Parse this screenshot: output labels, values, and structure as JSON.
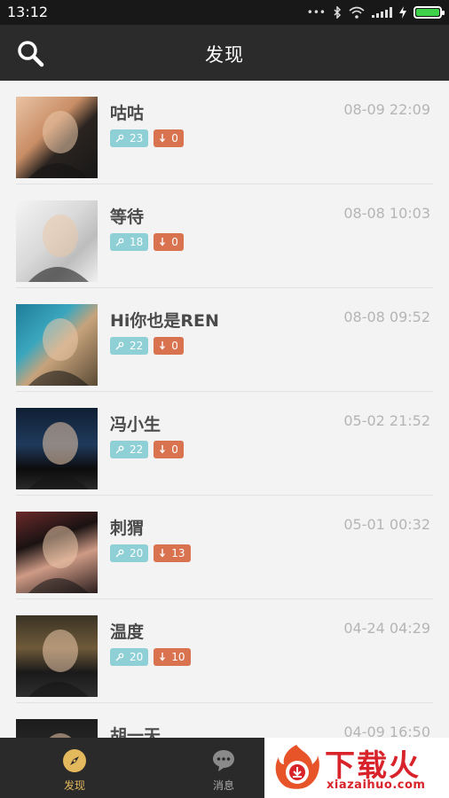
{
  "status_bar": {
    "time": "13:12",
    "battery_level": 1.0
  },
  "header": {
    "title": "发现",
    "search_icon": "search-icon"
  },
  "colors": {
    "like_badge": "#8fd0d6",
    "down_badge": "#d9724f",
    "nav_active": "#e4b85d",
    "header_bg": "#2b2b2b"
  },
  "feed": [
    {
      "name": "咕咕",
      "date": "08-09 22:09",
      "likes": "23",
      "downloads": "0"
    },
    {
      "name": "等待",
      "date": "08-08 10:03",
      "likes": "18",
      "downloads": "0"
    },
    {
      "name": "Hi你也是REN",
      "date": "08-08 09:52",
      "likes": "22",
      "downloads": "0"
    },
    {
      "name": "冯小生",
      "date": "05-02 21:52",
      "likes": "22",
      "downloads": "0"
    },
    {
      "name": "刺猬",
      "date": "05-01 00:32",
      "likes": "20",
      "downloads": "13"
    },
    {
      "name": "温度",
      "date": "04-24 04:29",
      "likes": "20",
      "downloads": "10"
    },
    {
      "name": "胡一天",
      "date": "04-09 16:50",
      "likes": "",
      "downloads": ""
    }
  ],
  "bottom_nav": [
    {
      "label": "发现",
      "icon": "compass-icon",
      "active": true
    },
    {
      "label": "消息",
      "icon": "chat-bubble-icon",
      "active": false
    }
  ],
  "watermark": {
    "text": "下载火",
    "url": "xiazaihuo.com"
  }
}
